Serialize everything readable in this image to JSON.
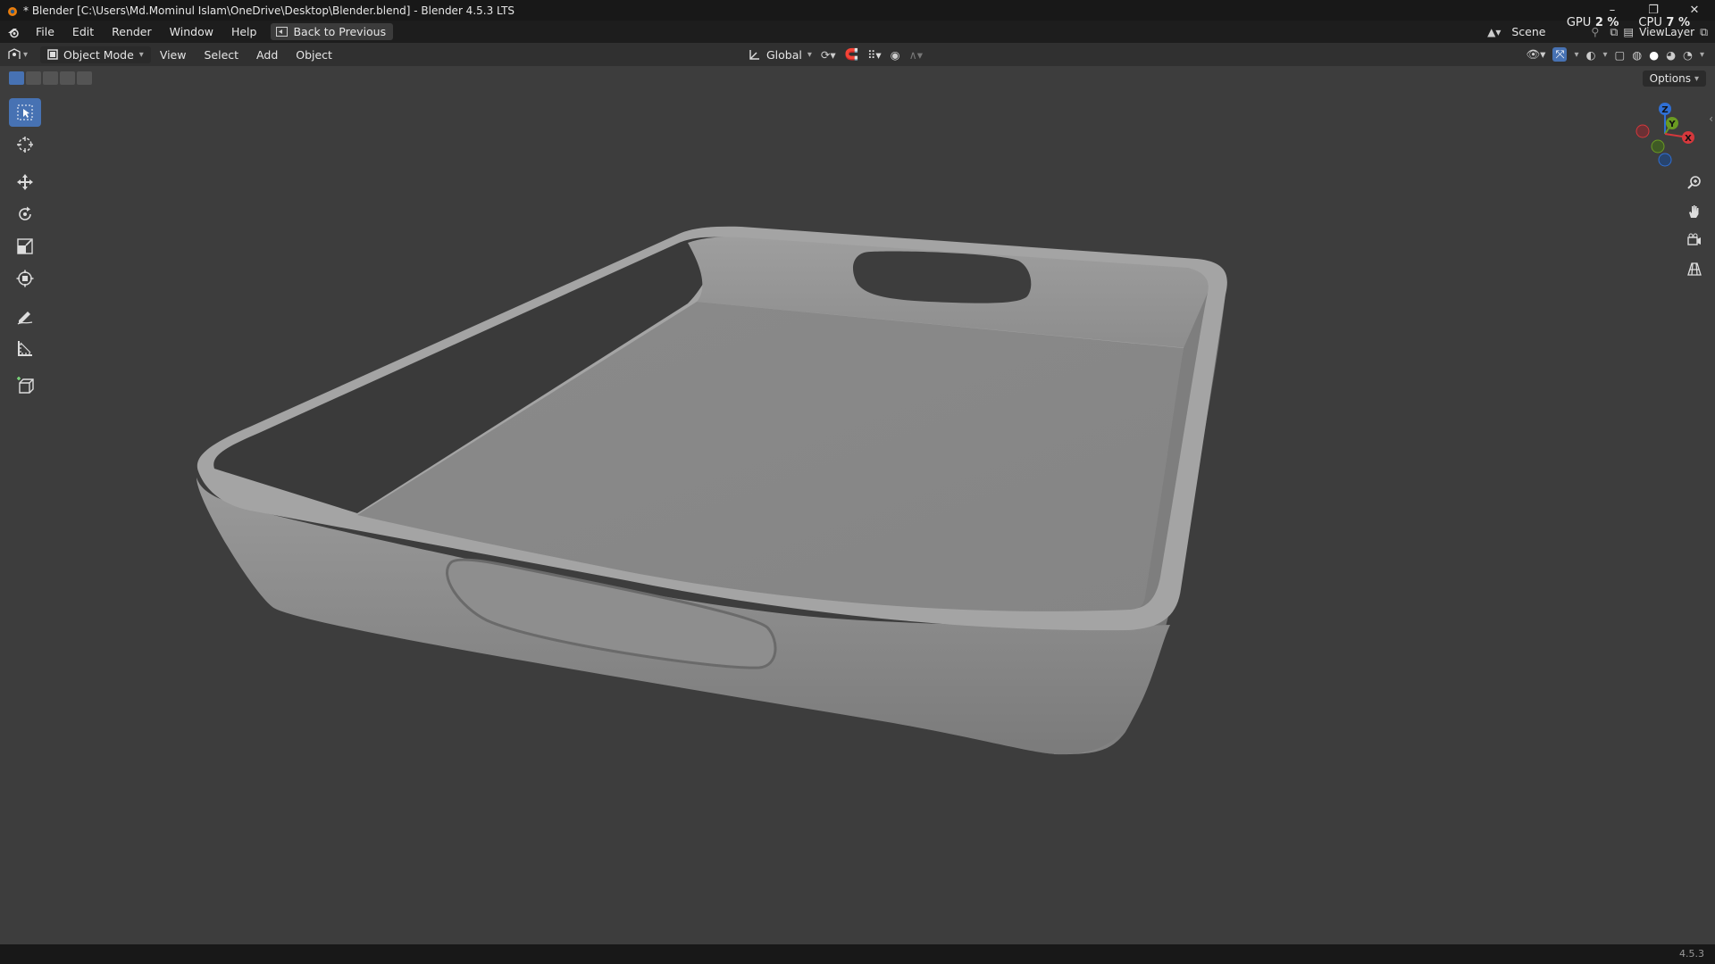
{
  "window": {
    "title": "* Blender [C:\\Users\\Md.Mominul Islam\\OneDrive\\Desktop\\Blender.blend] - Blender 4.5.3 LTS",
    "controls": [
      "–",
      "❐",
      "✕"
    ]
  },
  "topbar": {
    "menus": [
      "File",
      "Edit",
      "Render",
      "Window",
      "Help"
    ],
    "back_button": "Back to Previous",
    "scene": "Scene",
    "view_layer": "ViewLayer",
    "gpu_label": "GPU",
    "gpu_value": "2 %",
    "cpu_label": "CPU",
    "cpu_value": "7 %"
  },
  "header": {
    "mode": "Object Mode",
    "menus": [
      "View",
      "Select",
      "Add",
      "Object"
    ],
    "transform_orientation": "Global",
    "options": "Options"
  },
  "toolbar": {
    "tools": [
      "select-box",
      "cursor",
      "move",
      "rotate",
      "scale",
      "transform",
      "annotate",
      "measure",
      "add-cube"
    ],
    "active": "select-box"
  },
  "gizmo": {
    "axes": [
      "Z",
      "Y",
      "X"
    ]
  },
  "statusbar": {
    "version": "4.5.3"
  },
  "colors": {
    "accent": "#4772b3",
    "viewport_bg": "#3d3d3d",
    "mesh": "#8e8e8e"
  }
}
